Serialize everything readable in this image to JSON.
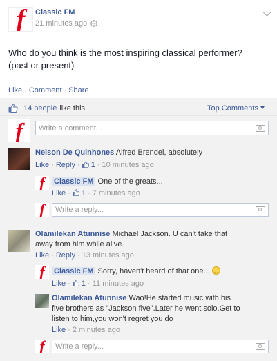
{
  "post": {
    "page_name": "Classic FM",
    "timestamp": "21 minutes ago",
    "privacy_icon": "globe-icon",
    "text_line1": "Who do you think is the most inspiring classical performer?",
    "text_line2": "(past or present)",
    "action_like": "Like",
    "action_comment": "Comment",
    "action_share": "Share"
  },
  "likes": {
    "count_text": "14 people",
    "suffix": "like this.",
    "top_comments": "Top Comments"
  },
  "compose": {
    "comment_placeholder": "Write a comment...",
    "reply_placeholder": "Write a reply..."
  },
  "logo_glyph": "f",
  "comments": [
    {
      "author": "Nelson De Quinhones",
      "text": "Alfred Brendel, absolutely",
      "like": "Like",
      "reply": "Reply",
      "likes": "1",
      "time": "10 minutes ago",
      "replies": [
        {
          "author": "Classic FM",
          "text": "One of the greats...",
          "like": "Like",
          "likes": "1",
          "time": "7 minutes ago"
        }
      ]
    },
    {
      "author": "Olamilekan Atunnise",
      "text_line1": "Michael Jackson. U can't take that",
      "text_line2": "away from him while alive.",
      "like": "Like",
      "reply": "Reply",
      "time": "13 minutes ago",
      "replies": [
        {
          "author": "Classic FM",
          "text": "Sorry, haven't heard of that one...",
          "like": "Like",
          "likes": "1",
          "time": "11 minutes ago"
        },
        {
          "author": "Olamilekan Atunnise",
          "text_line1": "Wao!He started music with his",
          "text_line2": "five brothers as \"Jackson five\".Later he went solo.Get to",
          "text_line3": "listen to him,you won't regret you do",
          "like": "Like",
          "time": "2 minutes ago"
        }
      ]
    }
  ],
  "sep": "·"
}
